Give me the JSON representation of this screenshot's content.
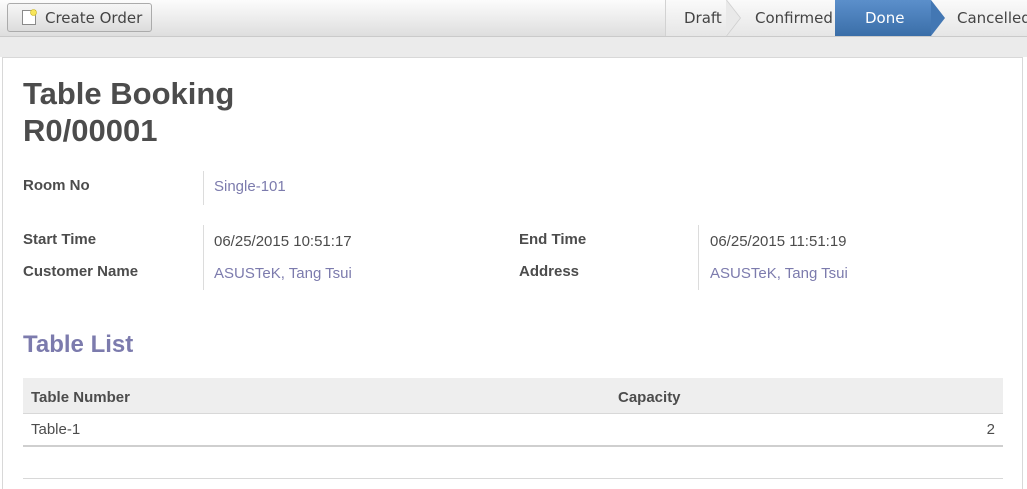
{
  "toolbar": {
    "create_label": "Create Order"
  },
  "statusbar": {
    "stages": [
      "Draft",
      "Confirmed",
      "Done",
      "Cancelled"
    ],
    "active": "Done"
  },
  "form": {
    "title_line1": "Table Booking",
    "title_line2": "R0/00001",
    "room_no_label": "Room No",
    "room_no_value": "Single-101",
    "start_time_label": "Start Time",
    "start_time_value": "06/25/2015 10:51:17",
    "end_time_label": "End Time",
    "end_time_value": "06/25/2015 11:51:19",
    "customer_label": "Customer Name",
    "customer_value": "ASUSTeK, Tang Tsui",
    "address_label": "Address",
    "address_value": "ASUSTeK, Tang Tsui"
  },
  "table_list": {
    "title": "Table List",
    "columns": [
      "Table Number",
      "Capacity"
    ],
    "rows": [
      {
        "table_number": "Table-1",
        "capacity": "2"
      }
    ]
  },
  "colors": {
    "link": "#7c7bad",
    "active_stage": "#4377b3"
  }
}
